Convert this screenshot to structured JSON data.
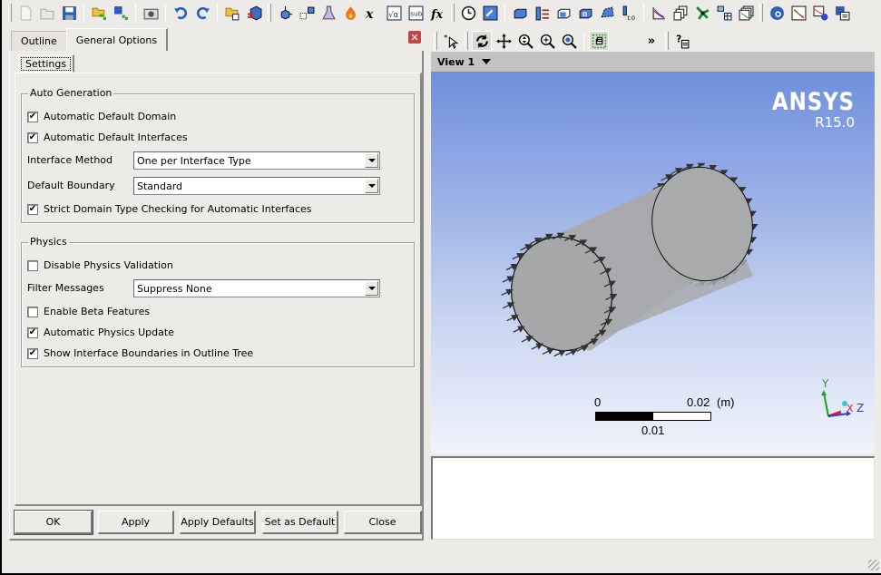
{
  "toolbar": {
    "groups": [
      [
        "new-file",
        "open-file",
        "save-file",
        "import-mesh",
        "save-case",
        "screenshot",
        "undo",
        "redo",
        "open-archive",
        "convert-3d"
      ],
      [
        "domain",
        "subdomain",
        "material",
        "reaction",
        "expression",
        "user-function",
        "subroutine",
        "additional-variable"
      ],
      [
        "simulation-control",
        "output-control",
        "boundary",
        "interface",
        "domain-interface",
        "mesh-connection",
        "initial-conditions"
      ],
      [
        "solver-control",
        "monitor",
        "turbo-mode",
        "mesh-adaption",
        "copy-results"
      ],
      [
        "define-run",
        "plot-monitor",
        "run-monitor",
        "save-run"
      ]
    ]
  },
  "viewer_toolbar": {
    "tools": [
      "select",
      "rotate",
      "pan",
      "zoom-box",
      "zoom",
      "fit-view",
      "toggle-outline"
    ],
    "overflow_label": "»",
    "help_icon": "help-context"
  },
  "left_panel": {
    "tabs": [
      {
        "label": "Outline",
        "active": false
      },
      {
        "label": "General Options",
        "active": true
      }
    ],
    "close_icon": "close-icon",
    "subtabs": [
      {
        "label": "Settings",
        "active": true
      }
    ],
    "auto_generation": {
      "title": "Auto Generation",
      "automatic_default_domain": {
        "label": "Automatic Default Domain",
        "checked": true
      },
      "automatic_default_interfaces": {
        "label": "Automatic Default Interfaces",
        "checked": true
      },
      "interface_method": {
        "label": "Interface Method",
        "value": "One per Interface Type"
      },
      "default_boundary": {
        "label": "Default Boundary",
        "value": "Standard"
      },
      "strict_domain_type": {
        "label": "Strict Domain Type Checking for Automatic Interfaces",
        "checked": true
      }
    },
    "physics": {
      "title": "Physics",
      "disable_physics_validation": {
        "label": "Disable Physics Validation",
        "checked": false
      },
      "filter_messages": {
        "label": "Filter Messages",
        "value": "Suppress None"
      },
      "enable_beta_features": {
        "label": "Enable Beta Features",
        "checked": false
      },
      "automatic_physics_update": {
        "label": "Automatic Physics Update",
        "checked": true
      },
      "show_interface_boundaries": {
        "label": "Show Interface Boundaries in Outline Tree",
        "checked": true
      }
    },
    "buttons": {
      "ok": "OK",
      "apply": "Apply",
      "apply_defaults": "Apply Defaults",
      "set_as_default": "Set as Default",
      "close": "Close"
    }
  },
  "viewer": {
    "view_name": "View 1",
    "logo": {
      "brand": "ANSYS",
      "version": "R15.0"
    },
    "scale_bar": {
      "start": "0",
      "mid": "0.01",
      "end": "0.02",
      "unit": "(m)"
    },
    "triad": {
      "x": "X",
      "y": "Y",
      "z": "Z"
    },
    "colors": {
      "x_axis": "#e02020",
      "y_axis": "#20a020",
      "z_axis": "#2040e0",
      "geometry": "#a8a9ab"
    }
  },
  "message_area": {
    "text": ""
  }
}
